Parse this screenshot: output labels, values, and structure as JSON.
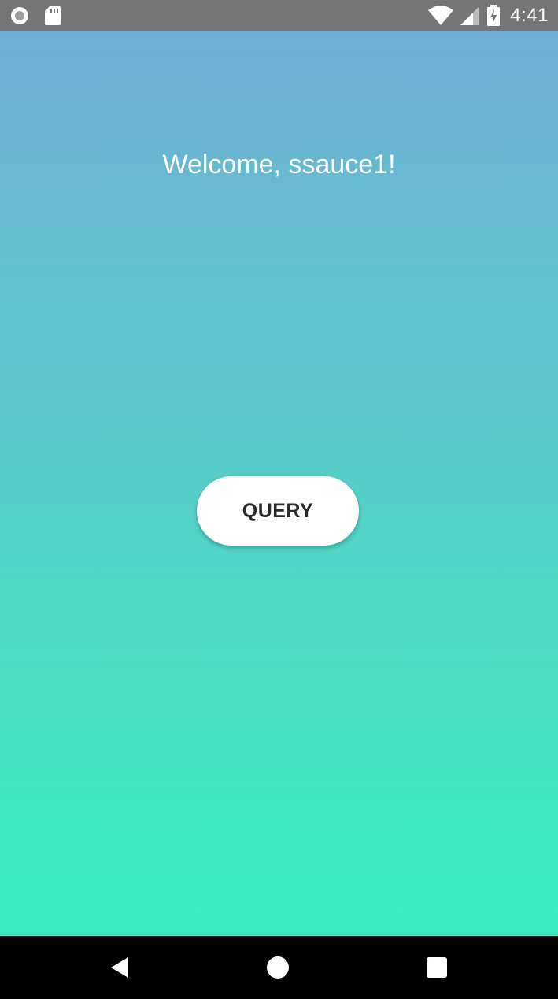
{
  "status_bar": {
    "time": "4:41",
    "icons": [
      "sync-circle-icon",
      "sd-card-icon",
      "wifi-icon",
      "cellular-signal-icon",
      "battery-charging-icon"
    ]
  },
  "app": {
    "welcome_text": "Welcome, ssauce1!",
    "query_button_label": "QUERY",
    "colors": {
      "gradient_top": "#6fafd6",
      "gradient_bottom": "#38edc0",
      "button_bg": "#ffffff",
      "button_text": "#2a2a2a"
    }
  },
  "nav_bar": {
    "buttons": [
      "back-icon",
      "home-icon",
      "recents-icon"
    ]
  }
}
